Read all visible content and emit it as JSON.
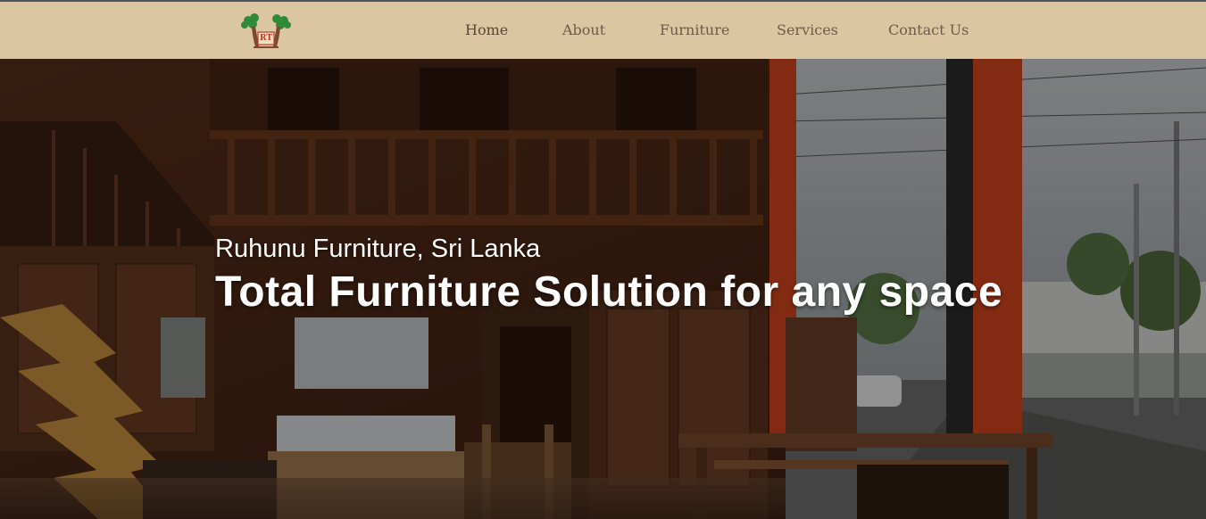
{
  "header": {
    "logo": {
      "text": "RT",
      "icon": "tree-logo-icon"
    },
    "nav": [
      {
        "label": "Home"
      },
      {
        "label": "About"
      },
      {
        "label": "Furniture"
      },
      {
        "label": "Services"
      },
      {
        "label": "Contact Us"
      }
    ]
  },
  "hero": {
    "kicker": "Ruhunu Furniture, Sri Lanka",
    "title": "Total Furniture Solution for any space"
  },
  "colors": {
    "header_bg": "#dcc6a2",
    "nav_text": "#6f5a48",
    "hero_text": "#ffffff",
    "accent_orange": "#d2461e"
  }
}
